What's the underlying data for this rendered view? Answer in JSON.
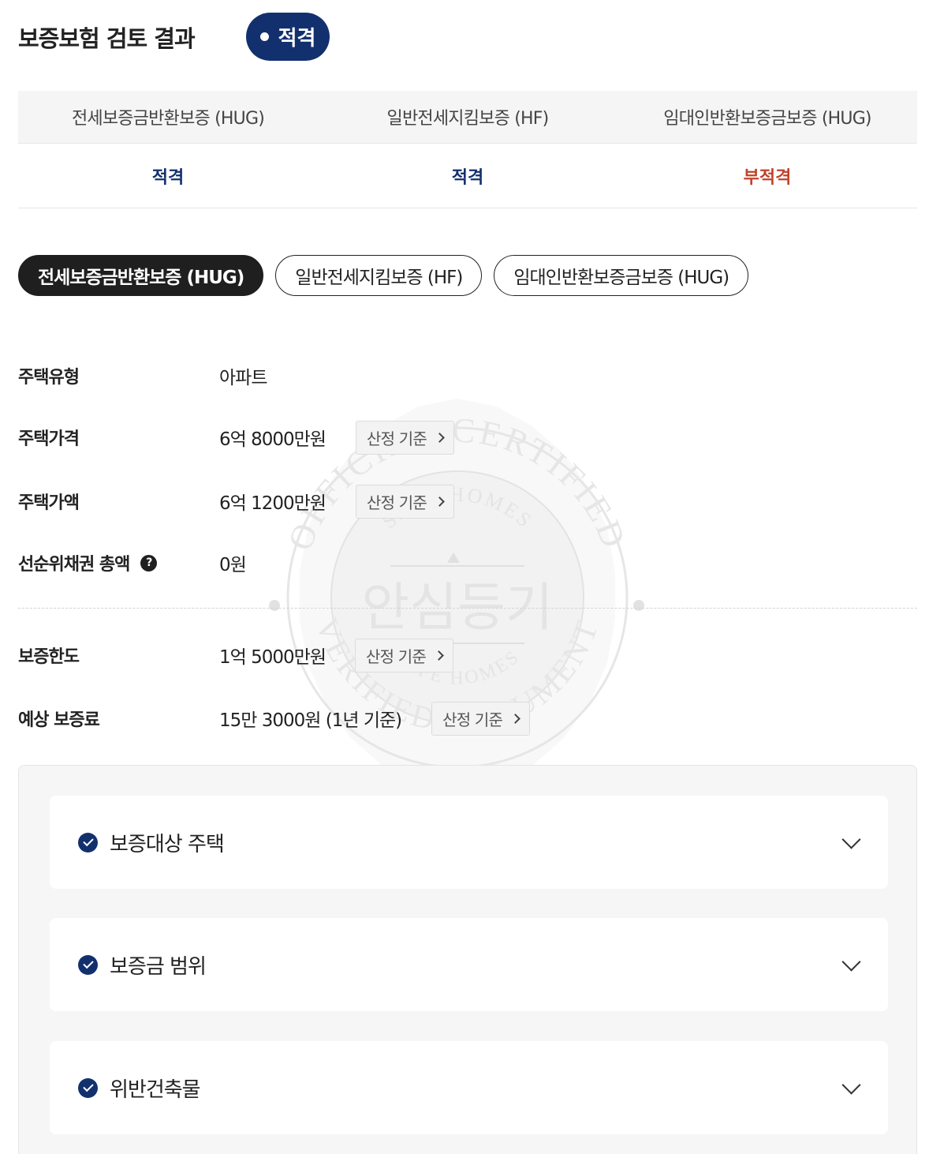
{
  "header": {
    "title": "보증보험 검토 결과",
    "status": "적격"
  },
  "summary": {
    "columns": [
      "전세보증금반환보증 (HUG)",
      "일반전세지킴보증 (HF)",
      "임대인반환보증금보증 (HUG)"
    ],
    "results": [
      "적격",
      "적격",
      "부적격"
    ]
  },
  "tabs": [
    "전세보증금반환보증 (HUG)",
    "일반전세지킴보증 (HF)",
    "임대인반환보증금보증 (HUG)"
  ],
  "info": {
    "house_type": {
      "label": "주택유형",
      "value": "아파트"
    },
    "house_price": {
      "label": "주택가격",
      "value": "6억 8000만원"
    },
    "house_amount": {
      "label": "주택가액",
      "value": "6억 1200만원"
    },
    "senior_claims": {
      "label": "선순위채권 총액",
      "value": "0원"
    },
    "guarantee_limit": {
      "label": "보증한도",
      "value": "1억 5000만원"
    },
    "expected_fee": {
      "label": "예상 보증료",
      "value": "15만 3000원 (1년 기준)"
    },
    "criteria_label": "산정 기준"
  },
  "accordion": [
    "보증대상 주택",
    "보증금 범위",
    "위반건축물"
  ],
  "watermark": {
    "text_outer_top": "OFFICIAL CERTIFIED",
    "text_outer_bottom": "VERIFIED DOCUMENT",
    "text_inner_top": "SAFE HOMES",
    "text_inner_bottom": "SAFE HOMES",
    "center": "안심등기"
  },
  "colors": {
    "accent": "#13306e",
    "fail": "#c0422a",
    "tab_active": "#1f1f1f"
  }
}
